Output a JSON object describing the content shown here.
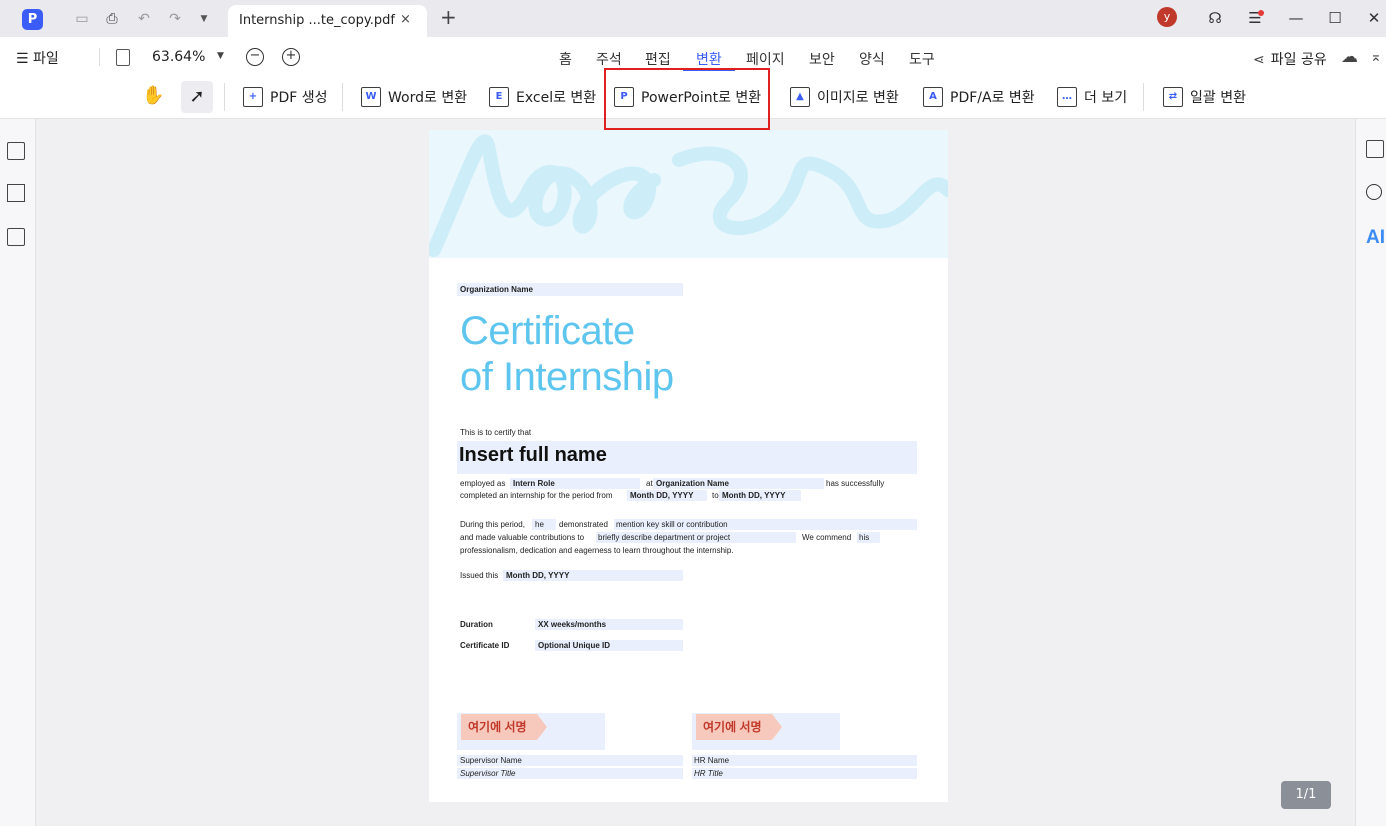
{
  "titlebar": {
    "app_logo": "P",
    "tab_title": "Internship ...te_copy.pdf",
    "tab_close": "×",
    "new_tab": "+",
    "avatar": "y"
  },
  "menubar": {
    "file": "☰ 파일",
    "zoom": "63.64%",
    "tabs": [
      "홈",
      "주석",
      "편집",
      "변환",
      "페이지",
      "보안",
      "양식",
      "도구"
    ],
    "active_tab": "변환",
    "share": "파일 공유"
  },
  "toolbar": {
    "create_pdf": "PDF 생성",
    "to_word": "Word로 변환",
    "to_excel": "Excel로 변환",
    "to_ppt": "PowerPoint로 변환",
    "to_image": "이미지로 변환",
    "to_pdfa": "PDF/A로 변환",
    "more": "더 보기",
    "batch": "일괄 변환"
  },
  "right_panel": {
    "ai": "AI"
  },
  "document": {
    "org_name": "Organization Name",
    "title_line1": "Certificate",
    "title_line2": "of Internship",
    "certify": "This is to certify that",
    "full_name": "Insert full name",
    "employed_as": "employed as",
    "intern_role": "Intern Role",
    "at": "at",
    "org_name2": "Organization Name",
    "has_successfully": "has successfully",
    "completed": "completed an internship for the period from",
    "start_date": "Month DD, YYYY",
    "to": "to",
    "end_date": "Month DD, YYYY",
    "during": "During this period,",
    "pronoun": "he",
    "demonstrated": "demonstrated",
    "skill": "mention key skill or contribution",
    "contributions": "and made valuable contributions to",
    "department": "briefly describe department or project",
    "we_commend": "We commend",
    "his": "his",
    "professionalism": "professionalism, dedication and eagerness to learn throughout the internship.",
    "issued": "Issued this",
    "issued_date": "Month DD, YYYY",
    "duration_label": "Duration",
    "duration_value": "XX weeks/months",
    "cert_id_label": "Certificate ID",
    "cert_id_value": "Optional Unique ID",
    "sign_here": "여기에 서명",
    "supervisor_name": "Supervisor Name",
    "supervisor_title": "Supervisor Title",
    "hr_name": "HR Name",
    "hr_title": "HR Title"
  },
  "page_indicator": "1/1"
}
